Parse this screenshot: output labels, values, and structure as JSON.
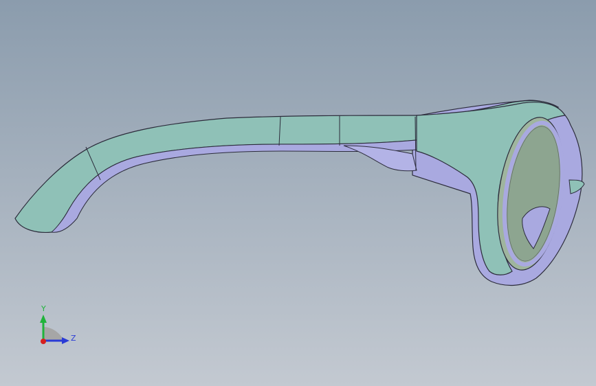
{
  "app": {
    "view": "cad-3d-viewport",
    "background_top": "#8b9cad",
    "background_bottom": "#c3c9d1"
  },
  "model": {
    "name": "sunglasses",
    "colors": {
      "face": "#8fc1b7",
      "face_light": "#a3d0c6",
      "side": "#a9a9e0",
      "side_dark": "#8a8ac8",
      "edge": "#2b2b3a",
      "lens": "#9fb59e",
      "lens_dark": "#7f9885"
    }
  },
  "triad": {
    "y_label": "Y",
    "z_label": "Z",
    "y_color": "#1fb33a",
    "z_color": "#2a3bd6",
    "x_color": "#d61f1f"
  }
}
